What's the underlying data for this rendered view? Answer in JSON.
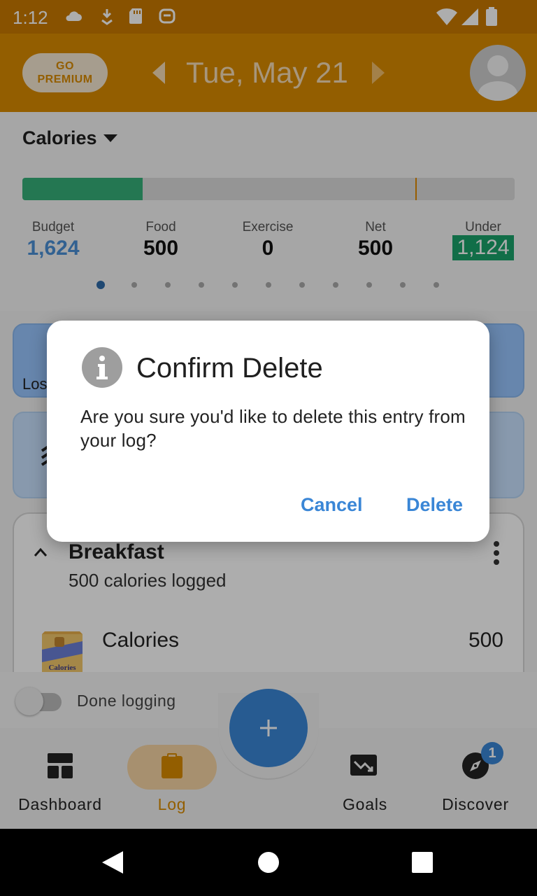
{
  "status_bar": {
    "time": "1:12",
    "icons": [
      "cloud-icon",
      "download-icon",
      "sd-card-icon",
      "app-icon",
      "wifi-icon",
      "signal-icon",
      "battery-icon"
    ]
  },
  "header": {
    "premium_line1": "GO",
    "premium_line2": "PREMIUM",
    "date": "Tue, May 21",
    "accent_color": "#d98b00"
  },
  "summary": {
    "selector_label": "Calories",
    "progress_fraction": 0.245,
    "marker_fraction": 0.798,
    "stats": [
      {
        "label": "Budget",
        "value": "1,624"
      },
      {
        "label": "Food",
        "value": "500"
      },
      {
        "label": "Exercise",
        "value": "0"
      },
      {
        "label": "Net",
        "value": "500"
      },
      {
        "label": "Under",
        "value": "1,124"
      }
    ],
    "page_count": 11,
    "active_page": 0
  },
  "cards": {
    "blue1_peek": "Los"
  },
  "log": {
    "meal_title": "Breakfast",
    "meal_subtitle": "500 calories logged",
    "item_name": "Calories",
    "item_value": "500",
    "item_icon_text": "Calories"
  },
  "done_logging": {
    "label": "Done logging",
    "checked": false
  },
  "nav": {
    "items": [
      {
        "label": "Dashboard",
        "icon": "dashboard-icon"
      },
      {
        "label": "Log",
        "icon": "clipboard-icon"
      },
      {
        "label": "Goals",
        "icon": "trend-down-icon"
      },
      {
        "label": "Discover",
        "icon": "compass-icon"
      }
    ],
    "active": "Log",
    "discover_badge": "1",
    "fab_icon": "plus-icon"
  },
  "dialog": {
    "title": "Confirm Delete",
    "message": "Are you sure you'd like to delete this entry from your log?",
    "cancel_label": "Cancel",
    "delete_label": "Delete",
    "button_color": "#3a86d6",
    "icon": "info-icon"
  }
}
